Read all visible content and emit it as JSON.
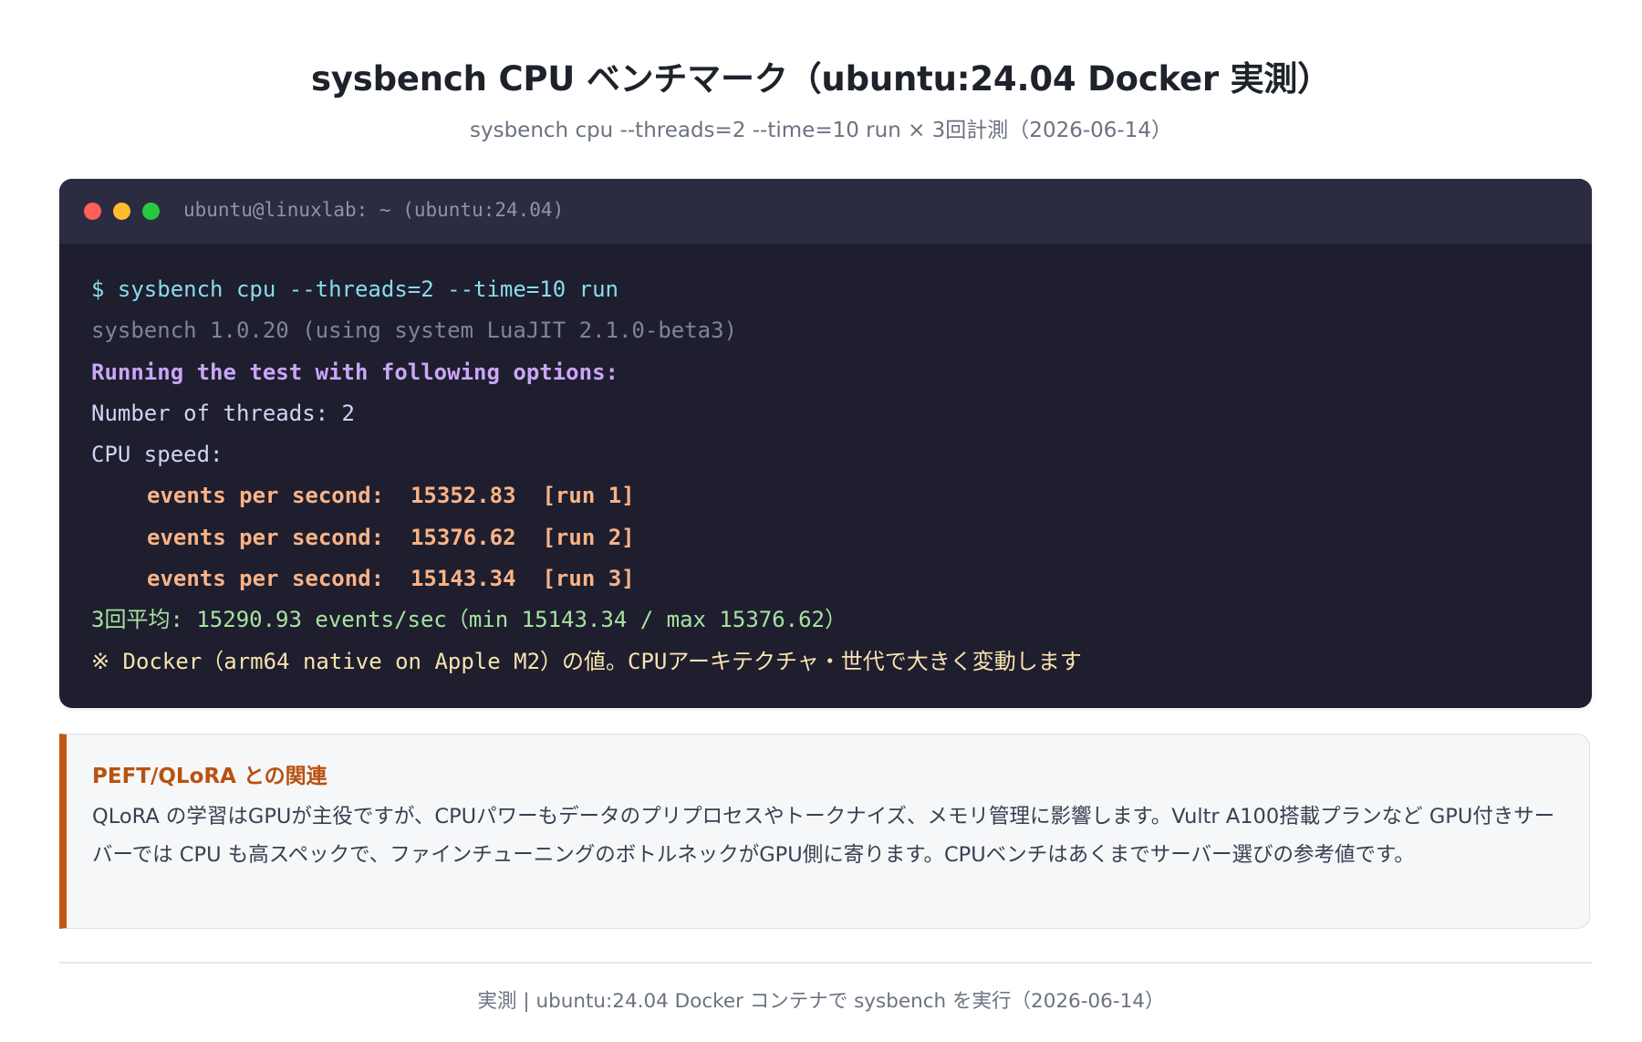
{
  "header": {
    "title": "sysbench CPU ベンチマーク（ubuntu:24.04 Docker 実測）",
    "subtitle": "sysbench cpu --threads=2 --time=10 run × 3回計測（2026-06-14）"
  },
  "terminal": {
    "window_title": "ubuntu@linuxlab: ~ (ubuntu:24.04)",
    "buttons": {
      "close_color": "#ff5f57",
      "minimize_color": "#febc2e",
      "maximize_color": "#28c840"
    },
    "lines": {
      "command": "$ sysbench cpu --threads=2 --time=10 run",
      "version": "sysbench 1.0.20 (using system LuaJIT 2.1.0-beta3)",
      "options_header": "Running the test with following options:",
      "threads": "Number of threads: 2",
      "cpu_speed": "CPU speed:",
      "run1": "events per second:  15352.83  [run 1]",
      "run2": "events per second:  15376.62  [run 2]",
      "run3": "events per second:  15143.34  [run 3]",
      "average": "3回平均: 15290.93 events/sec（min 15143.34 / max 15376.62）",
      "note": "※ Docker（arm64 native on Apple M2）の値。CPUアーキテクチャ・世代で大きく変動します"
    }
  },
  "callout": {
    "title": "PEFT/QLoRA との関連",
    "text": "QLoRA の学習はGPUが主役ですが、CPUパワーもデータのプリプロセスやトークナイズ、メモリ管理に影響します。Vultr A100搭載プランなど GPU付きサーバーでは CPU も高スペックで、ファインチューニングのボトルネックがGPU側に寄ります。CPUベンチはあくまでサーバー選びの参考値です。",
    "accent_color": "#c0560f"
  },
  "footer": {
    "text": "実測 | ubuntu:24.04 Docker コンテナで sysbench を実行（2026-06-14）"
  }
}
